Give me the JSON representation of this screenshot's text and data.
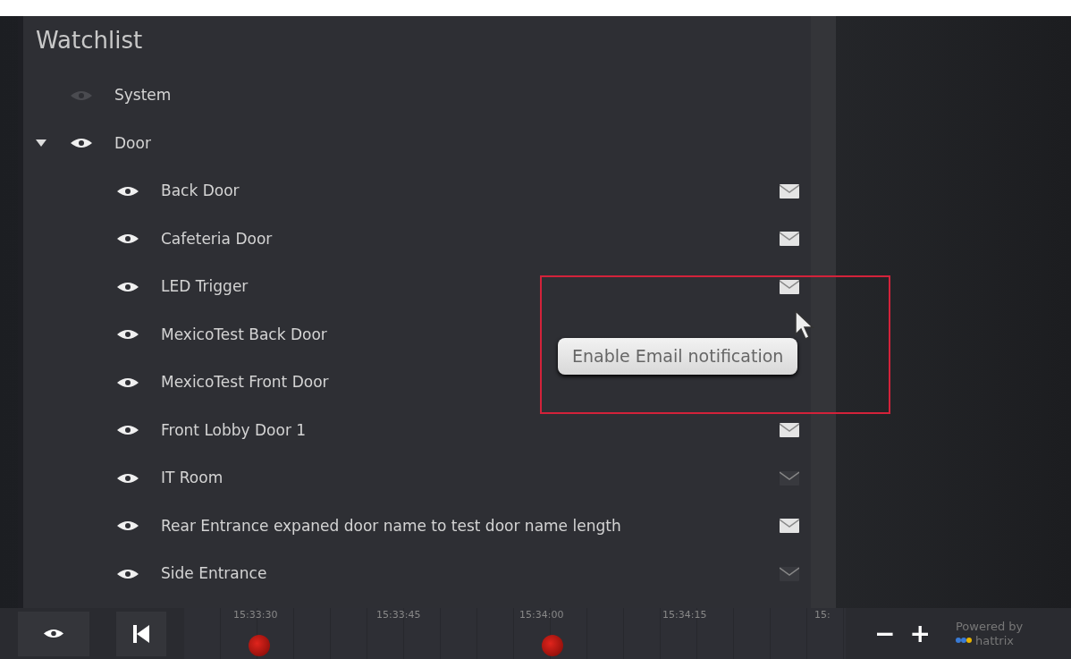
{
  "watchlist": {
    "title": "Watchlist",
    "items": [
      {
        "label": "System",
        "visible": false
      },
      {
        "label": "Door",
        "visible": true,
        "expanded": true,
        "children": [
          {
            "label": "Back Door",
            "visible": true,
            "email": true
          },
          {
            "label": "Cafeteria Door",
            "visible": true,
            "email": true
          },
          {
            "label": "LED Trigger",
            "visible": true,
            "email": true
          },
          {
            "label": "MexicoTest Back Door",
            "visible": true
          },
          {
            "label": "MexicoTest Front Door",
            "visible": true
          },
          {
            "label": "Front Lobby Door 1",
            "visible": true,
            "email": true
          },
          {
            "label": "IT Room",
            "visible": true,
            "email": false
          },
          {
            "label": "Rear Entrance expaned door name to test door name length",
            "visible": true,
            "email": true
          },
          {
            "label": "Side Entrance",
            "visible": true,
            "email": false
          }
        ]
      }
    ]
  },
  "tooltip": {
    "text": "Enable Email notification"
  },
  "timeline": {
    "ticks": [
      "15:33:30",
      "15:33:45",
      "15:34:00",
      "15:34:15",
      "15:"
    ],
    "zoom_out": "−",
    "zoom_in": "+"
  },
  "branding": {
    "line_1": "Powered by",
    "line_2": "hattrix"
  }
}
